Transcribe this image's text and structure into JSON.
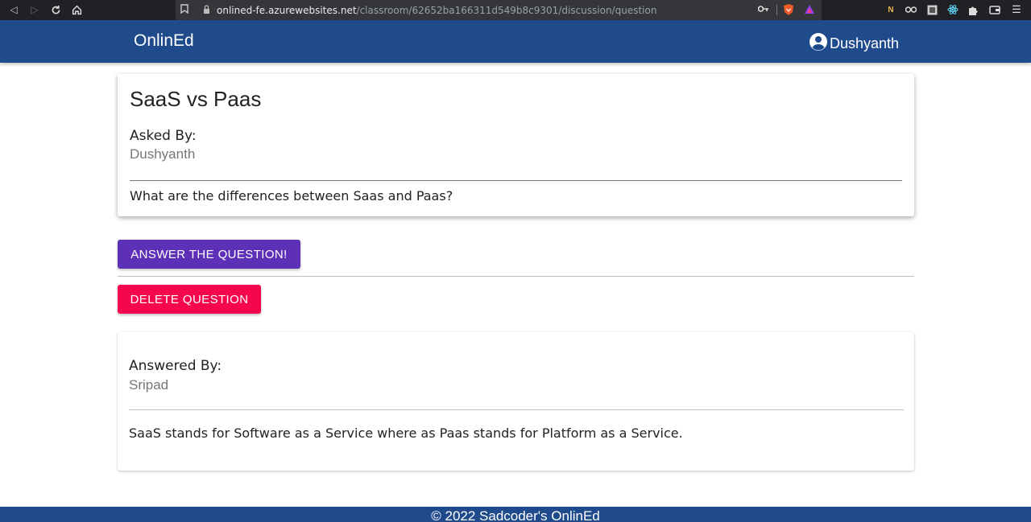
{
  "browser": {
    "url_host": "onlined-fe.azurewebsites.net",
    "url_path": "/classroom/62652ba166311d549b8c9301/discussion/question"
  },
  "header": {
    "brand": "OnlinEd",
    "user_name": "Dushyanth"
  },
  "question": {
    "title": "SaaS vs Paas",
    "asked_by_label": "Asked By:",
    "asked_by": "Dushyanth",
    "body": "What are the differences between Saas and Paas?"
  },
  "actions": {
    "answer_label": "ANSWER THE QUESTION!",
    "delete_label": "DELETE QUESTION"
  },
  "answer": {
    "answered_by_label": "Answered By:",
    "answered_by": "Sripad",
    "body": "SaaS stands for Software as a Service where as Paas stands for Platform as a Service."
  },
  "footer": {
    "text": "© 2022 Sadcoder's OnlinEd"
  },
  "colors": {
    "header_bg": "#1f4a8c",
    "answer_button": "#5e2fb7",
    "delete_button": "#f5064d"
  }
}
